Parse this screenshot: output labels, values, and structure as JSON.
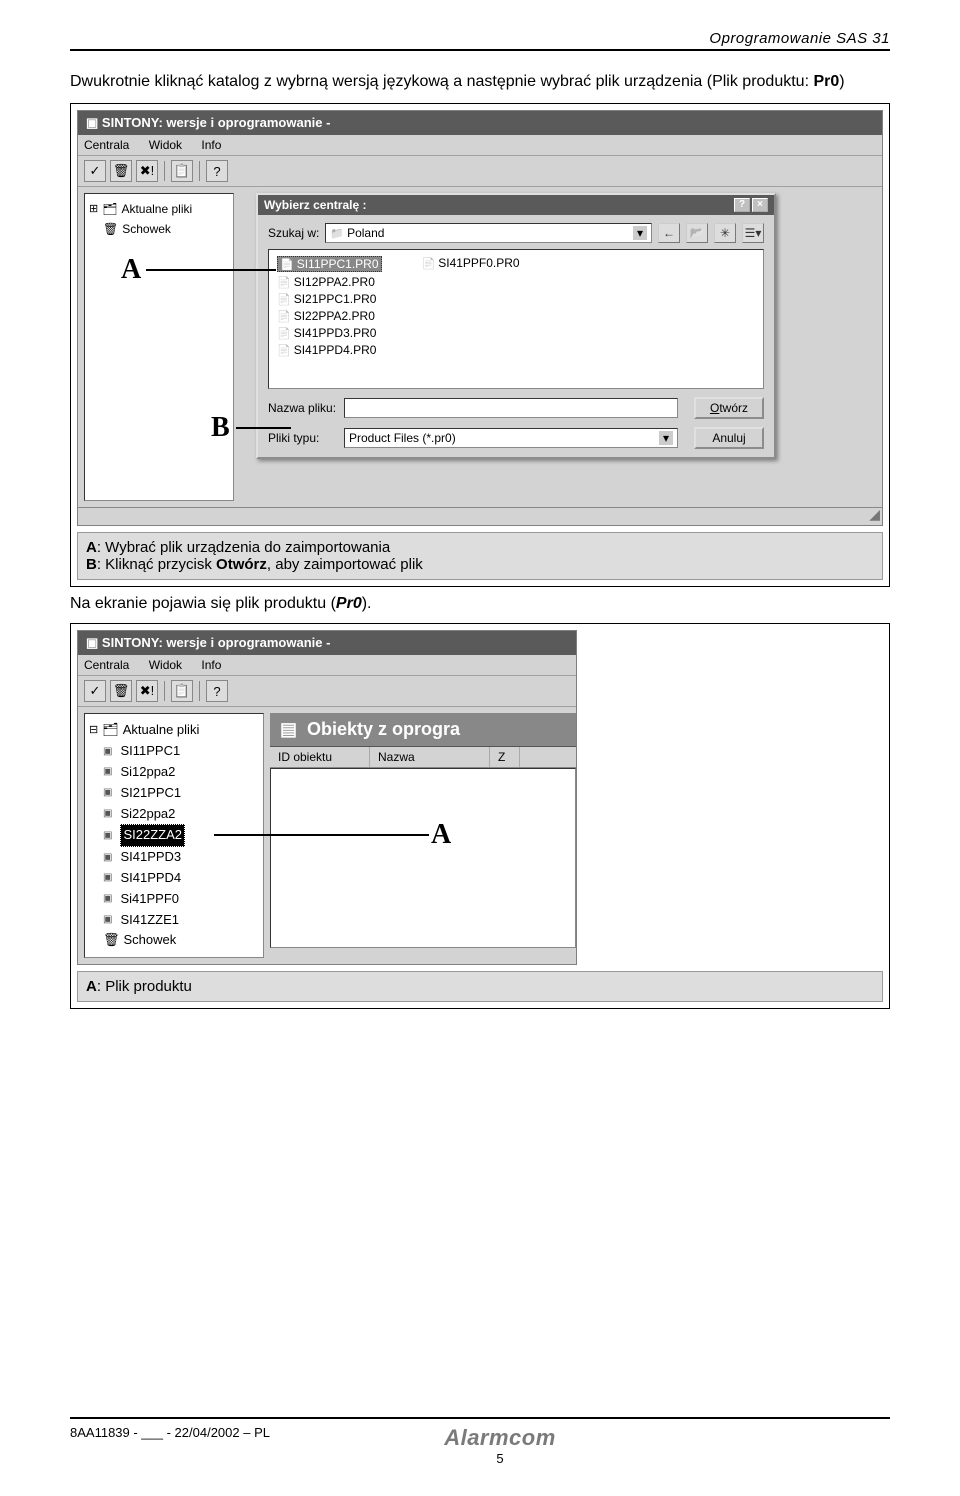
{
  "page": {
    "header_title": "Oprogramowanie SAS 31",
    "intro_text": "Dwukrotnie kliknąć katalog z wybrną wersją językową a następnie wybrać plik urządzenia (Plik produktu: ",
    "intro_bold": "Pr0",
    "intro_end": ")",
    "caption1_a": "A: Wybrać plik urządzenia do zaimportowania",
    "caption1_b_pre": "B: Kliknąć przycisk ",
    "caption1_b_bold": "Otwórz",
    "caption1_b_post": ", aby zaimportować plik",
    "between_pre": "Na ekranie pojawia się plik produktu (",
    "between_bold": "Pr0",
    "between_post": ").",
    "caption2": "A: Plik produktu",
    "footer_left": "8AA11839 - ___ - 22/04/2002 – PL",
    "page_num": "5",
    "logo": "Alarmcom"
  },
  "markers": {
    "A": "A",
    "B": "B"
  },
  "screenshot1": {
    "title": "SINTONY: wersje i oprogramowanie -",
    "menu": [
      "Centrala",
      "Widok",
      "Info"
    ],
    "toolbar_icons": [
      "✓",
      "🗑",
      "✖!",
      "📋",
      "?"
    ],
    "tree": {
      "root": "Aktualne pliki",
      "item2": "Schowek"
    },
    "dialog": {
      "title": "Wybierz centralę :",
      "search_label": "Szukaj w:",
      "search_value": "Poland",
      "files_col1": [
        "SI11PPC1.PR0",
        "SI12PPA2.PR0",
        "SI21PPC1.PR0",
        "SI22PPA2.PR0",
        "SI41PPD3.PR0",
        "SI41PPD4.PR0"
      ],
      "files_col2": [
        "SI41PPF0.PR0"
      ],
      "filename_label": "Nazwa pliku:",
      "filename_value": "",
      "filetype_label": "Pliki typu:",
      "filetype_value": "Product Files (*.pr0)",
      "open_btn": "Otwórz",
      "cancel_btn": "Anuluj"
    }
  },
  "screenshot2": {
    "title": "SINTONY: wersje i oprogramowanie -",
    "menu": [
      "Centrala",
      "Widok",
      "Info"
    ],
    "toolbar_icons": [
      "✓",
      "🗑",
      "✖!",
      "📋",
      "?"
    ],
    "tree_root": "Aktualne pliki",
    "tree_items": [
      "SI11PPC1",
      "Si12ppa2",
      "SI21PPC1",
      "Si22ppa2",
      "SI22ZZA2",
      "SI41PPD3",
      "SI41PPD4",
      "Si41PPF0",
      "SI41ZZE1"
    ],
    "tree_selected_index": 4,
    "tree_last": "Schowek",
    "panel_title": "Obiekty z oprogra",
    "columns": [
      "ID obiektu",
      "Nazwa",
      "Z"
    ]
  }
}
